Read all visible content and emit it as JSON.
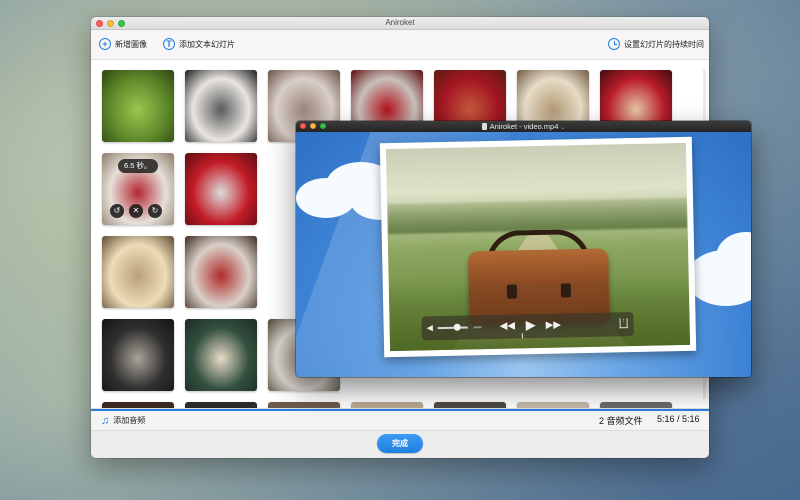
{
  "main_window": {
    "title": "Aniroket",
    "toolbar": {
      "add_image": {
        "icon": "plus-circle-icon",
        "glyph": "+",
        "label": "新增圖像"
      },
      "add_text_slide": {
        "icon": "text-circle-icon",
        "glyph": "T",
        "label": "添加文本幻灯片"
      },
      "set_duration": {
        "icon": "clock-icon",
        "label": "设置幻灯片的持续时间"
      }
    },
    "grid_tiles": [
      {
        "row": 1,
        "col": 1,
        "subject": "guitar-in-grass",
        "colors": [
          "#5f8a2a",
          "#9bc650",
          "#2e4412"
        ]
      },
      {
        "row": 1,
        "col": 2,
        "subject": "hand-with-camera",
        "colors": [
          "#e8e5e1",
          "#5a5a5a",
          "#1a1a1a"
        ]
      },
      {
        "row": 1,
        "col": 3,
        "subject": "hands-with-rings",
        "colors": [
          "#d8cfc9",
          "#9d8579",
          "#6a5047"
        ]
      },
      {
        "row": 1,
        "col": 4,
        "subject": "red-roses",
        "colors": [
          "#c7c0ba",
          "#b0121c",
          "#5d0a0d"
        ]
      },
      {
        "row": 1,
        "col": 5,
        "subject": "red-photo-collage",
        "colors": [
          "#a31621",
          "#c55a3e",
          "#5a1d14"
        ]
      },
      {
        "row": 1,
        "col": 6,
        "subject": "hand-writing-letter",
        "colors": [
          "#e7dcc6",
          "#b49a77",
          "#6e5a44"
        ]
      },
      {
        "row": 1,
        "col": 7,
        "subject": "champagne-toast",
        "colors": [
          "#b91c2b",
          "#e7c9a6",
          "#3f0c0f"
        ]
      },
      {
        "row": 2,
        "col": 1,
        "subject": "gift-box-ribbon",
        "colors": [
          "#e5e0d8",
          "#b42634",
          "#8c7a66"
        ]
      },
      {
        "row": 2,
        "col": 2,
        "subject": "red-vespa-headlight",
        "colors": [
          "#c21b26",
          "#dcdcdc",
          "#5c0e12"
        ]
      },
      {
        "row": 3,
        "col": 1,
        "subject": "open-book",
        "colors": [
          "#eddcb7",
          "#b9a07b",
          "#5e4b33"
        ]
      },
      {
        "row": 3,
        "col": 2,
        "subject": "football-helmet",
        "colors": [
          "#d9d0c8",
          "#b02a2a",
          "#3c2a20"
        ]
      },
      {
        "row": 4,
        "col": 1,
        "subject": "person-in-jacket",
        "colors": [
          "#2f2f2f",
          "#a9a297",
          "#141414"
        ]
      },
      {
        "row": 4,
        "col": 2,
        "subject": "lotus-flower",
        "colors": [
          "#33503f",
          "#e7dcc7",
          "#1c2b22"
        ]
      },
      {
        "row": 4,
        "col": 3,
        "subject": "dry-grass",
        "colors": [
          "#d9d6cf",
          "#9b8a73",
          "#4d4032"
        ]
      }
    ],
    "hover_tile": {
      "duration": "6.5 秒。",
      "actions": [
        {
          "name": "rotate-left-icon",
          "glyph": "↺"
        },
        {
          "name": "delete-icon",
          "glyph": "✕"
        },
        {
          "name": "rotate-right-icon",
          "glyph": "↻"
        }
      ]
    },
    "status": {
      "add_audio": {
        "icon": "music-note-icon",
        "glyph": "♫",
        "label": "添加音频"
      },
      "audio_count": "2 音频文件",
      "time": "5:16 / 5:16",
      "progress": 1.0,
      "accent": "#2a7de1"
    },
    "footer": {
      "done_label": "完成"
    }
  },
  "video_window": {
    "title": "Aniroket - video.mp4",
    "player": {
      "volume": 0.55,
      "controls": [
        {
          "name": "rewind-icon",
          "glyph": "◀◀"
        },
        {
          "name": "play-icon",
          "glyph": "▶"
        },
        {
          "name": "fast-forward-icon",
          "glyph": "▶▶"
        }
      ],
      "speaker_glyph": "◀",
      "share_glyph": "↑"
    }
  }
}
